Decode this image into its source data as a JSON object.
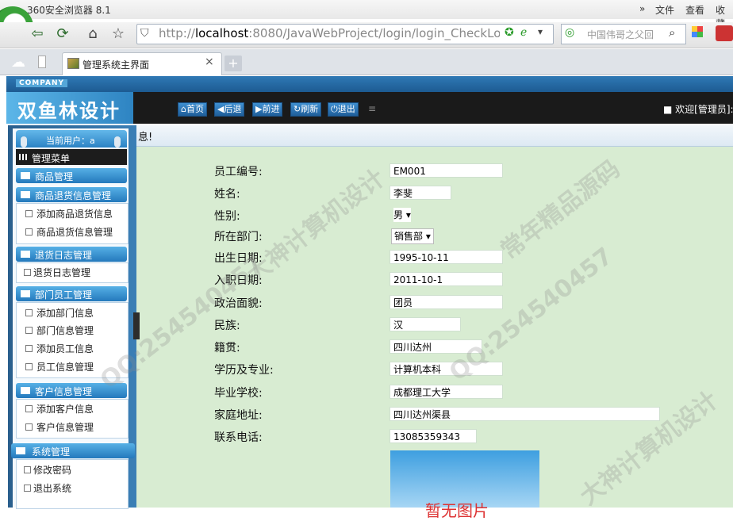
{
  "browser": {
    "title": "360安全浏览器 8.1",
    "menu": [
      "文件",
      "查看",
      "收藏"
    ],
    "address": {
      "prefix": "http://",
      "host": "localhost",
      "rest": ":8080/JavaWebProject/login/login_CheckLogin"
    },
    "search_placeholder": "中国伟哥之父回",
    "tab_title": "管理系统主界面"
  },
  "header": {
    "company": "COMPANY",
    "logo_text": "双鱼林设计",
    "nav_buttons": [
      "首页",
      "后退",
      "前进",
      "刷新",
      "退出"
    ],
    "welcome": "欢迎[管理员]:"
  },
  "sidebar": {
    "current_user": "当前用户：a",
    "menu_title": "管理菜单",
    "groups": [
      {
        "label": "商品管理",
        "items": []
      },
      {
        "label": "商品退货信息管理",
        "items": [
          "添加商品退货信息",
          "商品退货信息管理"
        ]
      },
      {
        "label": "退货日志管理",
        "items": [
          "退货日志管理"
        ]
      },
      {
        "label": "部门员工管理",
        "items": [
          "添加部门信息",
          "部门信息管理",
          "添加员工信息",
          "员工信息管理"
        ]
      },
      {
        "label": "客户信息管理",
        "items": [
          "添加客户信息",
          "客户信息管理"
        ]
      },
      {
        "label": "系统管理",
        "items": [
          "修改密码",
          "退出系统"
        ]
      }
    ]
  },
  "form": {
    "bar_text": "息!",
    "fields": [
      {
        "label": "员工编号:",
        "value": "EM001"
      },
      {
        "label": "姓名:",
        "value": "李斐"
      },
      {
        "label": "性别:",
        "value": "男"
      },
      {
        "label": "所在部门:",
        "value": "销售部"
      },
      {
        "label": "出生日期:",
        "value": "1995-10-11"
      },
      {
        "label": "入职日期:",
        "value": "2011-10-1"
      },
      {
        "label": "政治面貌:",
        "value": "团员"
      },
      {
        "label": "民族:",
        "value": "汉"
      },
      {
        "label": "籍贯:",
        "value": "四川达州"
      },
      {
        "label": "学历及专业:",
        "value": "计算机本科"
      },
      {
        "label": "毕业学校:",
        "value": "成都理工大学"
      },
      {
        "label": "家庭地址:",
        "value": "四川达州渠县"
      },
      {
        "label": "联系电话:",
        "value": "13085359343"
      }
    ],
    "photo_caption": "暂无图片"
  },
  "watermark": [
    "QQ:254540457",
    "大神计算机设计",
    "常年精品源码"
  ]
}
